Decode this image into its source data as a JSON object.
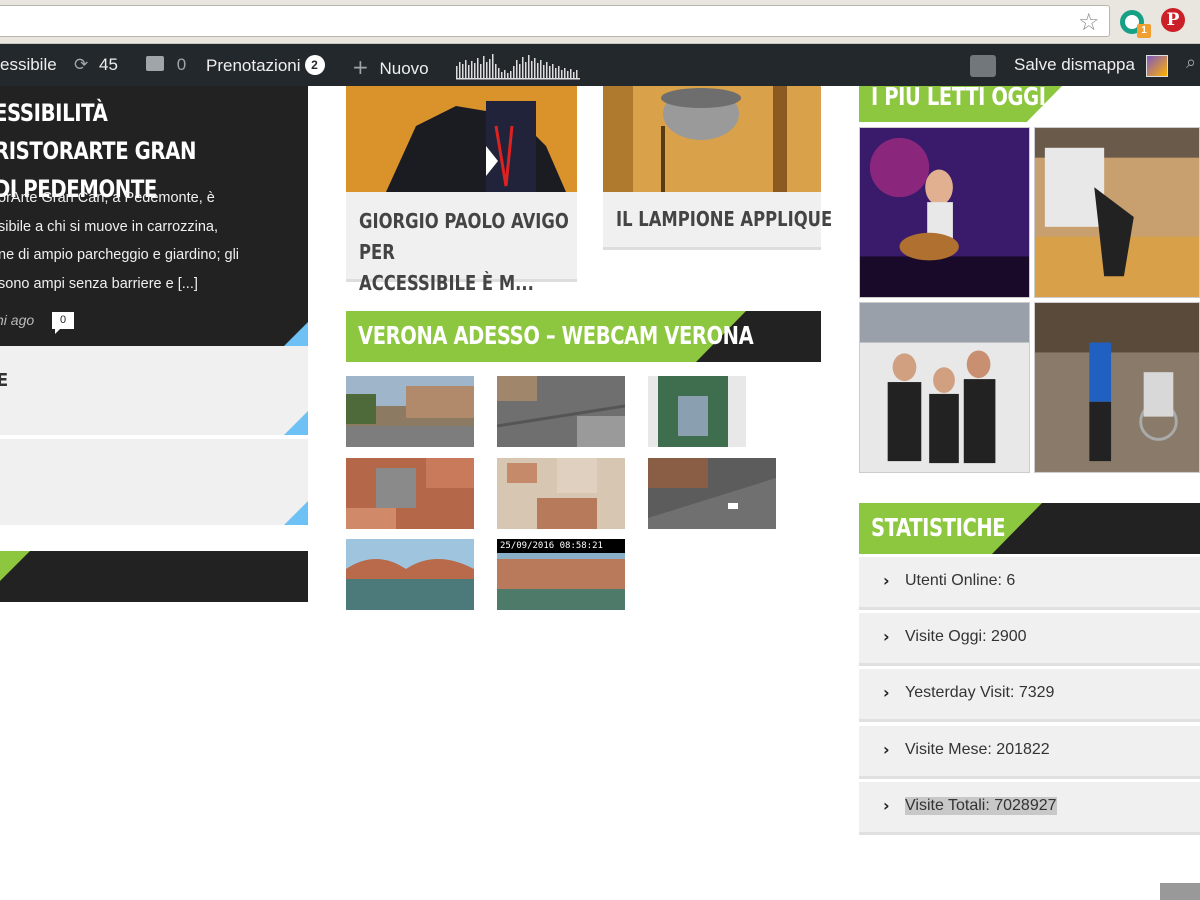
{
  "adminbar": {
    "site_name": "essibile",
    "updates_count": "45",
    "comments_count": "0",
    "bookings_label": "Prenotazioni",
    "bookings_count": "2",
    "new_label": "Nuovo",
    "greeting": "Salve dismappa"
  },
  "left": {
    "title": "essibilità RistorArte Gran\n di Pedemonte",
    "excerpt": "orArte Gran Can, a Pedemonte, è\nsibile a chi si muove in carrozzina,\nne di ampio parcheggio e giardino; gli\nsono ampi senza barriere e  [...]",
    "meta": "ni ago",
    "comments": "0",
    "box1_text": "E"
  },
  "middle": {
    "posts": [
      {
        "title": "Giorgio Paolo Avigo per\nAccessibile è m..."
      },
      {
        "title": "Il lampione applique"
      }
    ],
    "webcam_section_title": "Verona adesso – Webcam Verona",
    "webcam_timestamp": "25/09/2016 08:58:21"
  },
  "right": {
    "most_read_title": "I più letti oggi",
    "stats_title": "Statistiche",
    "stats": [
      "Utenti Online: 6",
      "Visite Oggi: 2900",
      "Yesterday Visit: 7329",
      "Visite Mese: 201822",
      "Visite Totali: 7028927"
    ]
  },
  "icons": {
    "star": "star-icon",
    "updates": "refresh-icon",
    "comments": "comment-icon",
    "new": "plus-icon",
    "search": "search-icon"
  },
  "colors": {
    "accent_green": "#8dc63f",
    "dark": "#222222",
    "admin_bar": "#23282d",
    "corner_blue": "#6ec1f5"
  }
}
